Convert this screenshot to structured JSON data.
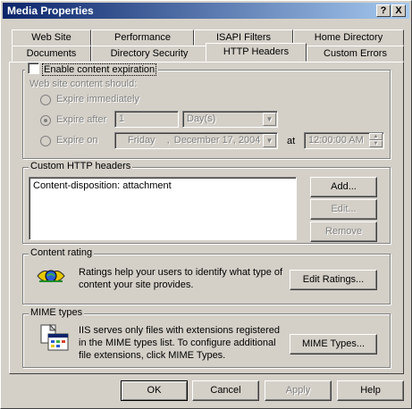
{
  "window": {
    "title": "Media Properties",
    "help_glyph": "?",
    "close_glyph": "X"
  },
  "tabs_back": [
    "Web Site",
    "Performance",
    "ISAPI Filters",
    "Home Directory"
  ],
  "tabs_front": [
    "Documents",
    "Directory Security",
    "HTTP Headers",
    "Custom Errors"
  ],
  "active_tab": "HTTP Headers",
  "expiration": {
    "enable_label": "Enable content expiration",
    "enabled": false,
    "subtitle": "Web site content should:",
    "opt_immediately": "Expire immediately",
    "opt_after": "Expire after",
    "opt_on": "Expire on",
    "after_value": "1",
    "after_unit": "Day(s)",
    "date_weekday": "Friday",
    "date_sep": ",",
    "date_value": "December 17, 2004",
    "at_label": "at",
    "time_value": "12:00:00 AM"
  },
  "custom_headers": {
    "label": "Custom HTTP headers",
    "items": [
      "Content-disposition: attachment"
    ],
    "add": "Add...",
    "edit": "Edit...",
    "remove": "Remove"
  },
  "rating": {
    "label": "Content rating",
    "text_line1": "Ratings help your users to identify what type of",
    "text_line2": "content your site provides.",
    "button": "Edit Ratings..."
  },
  "mime": {
    "label": "MIME types",
    "text_line1": "IIS serves only files with extensions registered",
    "text_line2": "in the MIME types list. To configure additional",
    "text_line3": "file extensions, click MIME Types.",
    "button": "MIME Types..."
  },
  "footer": {
    "ok": "OK",
    "cancel": "Cancel",
    "apply": "Apply",
    "help": "Help"
  },
  "colors": {
    "title_gradient_start": "#0a246a",
    "title_gradient_end": "#a6caf0",
    "face": "#d4d0c8",
    "disabled_text": "#808080"
  }
}
